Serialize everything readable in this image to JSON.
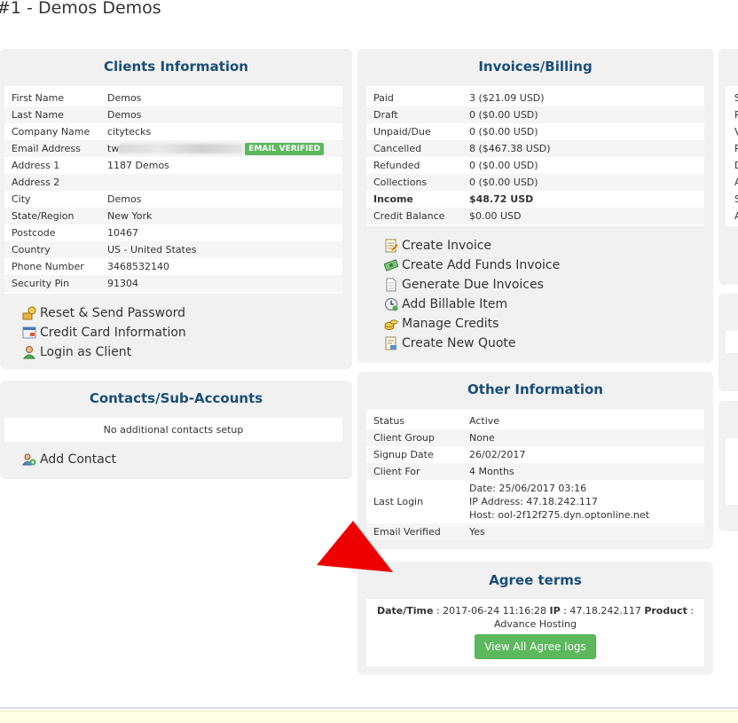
{
  "page": {
    "title": "#1 - Demos Demos"
  },
  "clients_info": {
    "title": "Clients Information",
    "rows": [
      {
        "label": "First Name",
        "value": "Demos"
      },
      {
        "label": "Last Name",
        "value": "Demos"
      },
      {
        "label": "Company Name",
        "value": "citytecks"
      },
      {
        "label": "Email Address",
        "value": "tw"
      },
      {
        "label": "Address 1",
        "value": "1187 Demos"
      },
      {
        "label": "Address 2",
        "value": ""
      },
      {
        "label": "City",
        "value": "Demos"
      },
      {
        "label": "State/Region",
        "value": "New York"
      },
      {
        "label": "Postcode",
        "value": "10467"
      },
      {
        "label": "Country",
        "value": "US - United States"
      },
      {
        "label": "Phone Number",
        "value": "3468532140"
      },
      {
        "label": "Security Pin",
        "value": "91304"
      }
    ],
    "email_badge": "EMAIL VERIFIED",
    "links": {
      "reset": "Reset & Send Password",
      "credit_card": "Credit Card Information",
      "login": "Login as Client"
    }
  },
  "contacts": {
    "title": "Contacts/Sub-Accounts",
    "empty_text": "No additional contacts setup",
    "add_label": "Add Contact"
  },
  "invoices": {
    "title": "Invoices/Billing",
    "rows": [
      {
        "label": "Paid",
        "value": "3 ($21.09 USD)"
      },
      {
        "label": "Draft",
        "value": "0 ($0.00 USD)"
      },
      {
        "label": "Unpaid/Due",
        "value": "0 ($0.00 USD)"
      },
      {
        "label": "Cancelled",
        "value": "8 ($467.38 USD)"
      },
      {
        "label": "Refunded",
        "value": "0 ($0.00 USD)"
      },
      {
        "label": "Collections",
        "value": "0 ($0.00 USD)"
      },
      {
        "label": "Income",
        "value": "$48.72 USD"
      },
      {
        "label": "Credit Balance",
        "value": "$0.00 USD"
      }
    ],
    "links": {
      "create_invoice": "Create Invoice",
      "add_funds": "Create Add Funds Invoice",
      "generate_due": "Generate Due Invoices",
      "billable_item": "Add Billable Item",
      "manage_credits": "Manage Credits",
      "new_quote": "Create New Quote"
    }
  },
  "other_info": {
    "title": "Other Information",
    "rows": [
      {
        "label": "Status",
        "value": "Active"
      },
      {
        "label": "Client Group",
        "value": "None"
      },
      {
        "label": "Signup Date",
        "value": "26/02/2017"
      },
      {
        "label": "Client For",
        "value": "4 Months"
      }
    ],
    "last_login": {
      "label": "Last Login",
      "date": "Date: 25/06/2017 03:16",
      "ip": "IP Address: 47.18.242.117",
      "host": "Host: ool-2f12f275.dyn.optonline.net"
    },
    "email_verified": {
      "label": "Email Verified",
      "value": "Yes"
    }
  },
  "agree_terms": {
    "title": "Agree terms",
    "datetime_label": "Date/Time",
    "datetime_value": " : 2017-06-24 11:16:28 ",
    "ip_label": "IP",
    "ip_value": " : 47.18.242.117 ",
    "product_label": "Product",
    "product_value": " : Advance Hosting",
    "button": "View All Agree logs"
  },
  "right_stub_letters": [
    "S",
    "R",
    "V",
    "R",
    "D",
    "A",
    "S",
    "A"
  ],
  "colors": {
    "accent": "#1a4d78",
    "success": "#5cb85c",
    "arrow": "#ee0000"
  },
  "icons": [
    "key-icon",
    "credit-card-icon",
    "user-login-icon",
    "add-contact-icon",
    "invoice-icon",
    "add-funds-icon",
    "document-icon",
    "billable-clock-icon",
    "coins-icon",
    "quote-icon",
    "red-arrow-icon"
  ]
}
